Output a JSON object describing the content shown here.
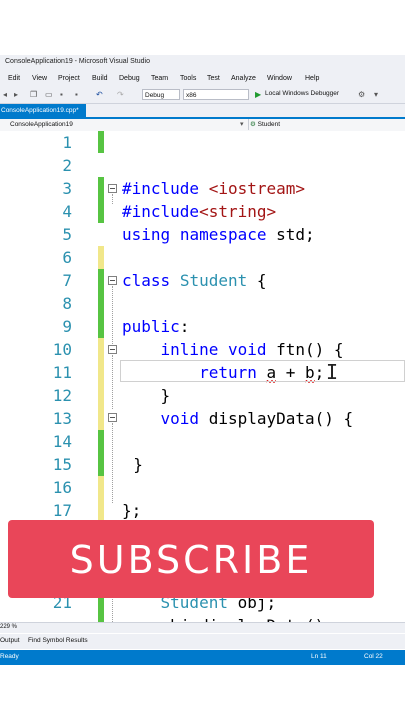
{
  "window": {
    "title": "ConsoleApplication19 - Microsoft Visual Studio"
  },
  "menu": [
    "Edit",
    "View",
    "Project",
    "Build",
    "Debug",
    "Team",
    "Tools",
    "Test",
    "Analyze",
    "Window",
    "Help"
  ],
  "toolbar": {
    "config": "Debug",
    "platform": "x86",
    "run_label": "Local Windows Debugger"
  },
  "tab": {
    "file": "ConsoleApplication19.cpp*"
  },
  "navbar": {
    "scope": "ConsoleApplication19",
    "member": "Student"
  },
  "editor": {
    "lines": [
      {
        "n": "1",
        "text": ""
      },
      {
        "n": "2",
        "text": ""
      },
      {
        "n": "3",
        "text": "#include <iostream>"
      },
      {
        "n": "4",
        "text": "#include<string>"
      },
      {
        "n": "5",
        "text": "using namespace std;"
      },
      {
        "n": "6",
        "text": ""
      },
      {
        "n": "7",
        "text": "class Student {"
      },
      {
        "n": "8",
        "text": ""
      },
      {
        "n": "9",
        "text": "public:"
      },
      {
        "n": "10",
        "text": "    inline void ftn() {"
      },
      {
        "n": "11",
        "text": "        return a + b;"
      },
      {
        "n": "12",
        "text": "    }"
      },
      {
        "n": "13",
        "text": "    void displayData() {"
      },
      {
        "n": "14",
        "text": ""
      },
      {
        "n": "15",
        "text": "  }"
      },
      {
        "n": "16",
        "text": ""
      },
      {
        "n": "17",
        "text": "};"
      },
      {
        "n": "21",
        "text": "    Student obj;"
      },
      {
        "n": "",
        "text": "    obj.displayData();"
      }
    ]
  },
  "banner": {
    "text": "SUBSCRIBE"
  },
  "zoom": "229 %",
  "panels": {
    "output": "Output",
    "find": "Find Symbol Results"
  },
  "status": {
    "state": "Ready",
    "line": "Ln 11",
    "col": "Col 22"
  },
  "colors": {
    "accent": "#007acc",
    "banner": "#e94659",
    "keyword": "#0000ff",
    "type": "#2b91af",
    "string": "#a31515"
  }
}
